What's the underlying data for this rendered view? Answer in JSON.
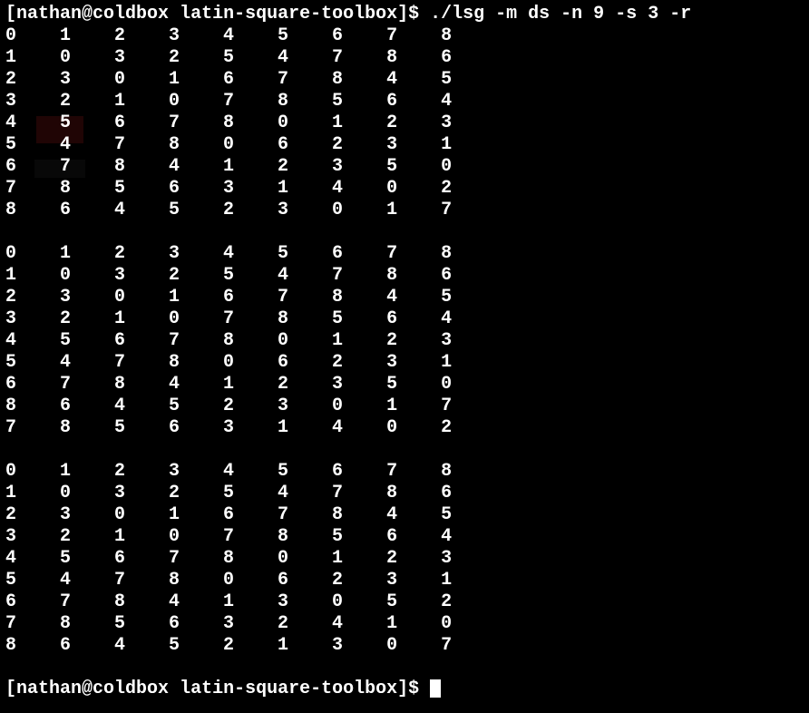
{
  "prompt": {
    "user": "nathan",
    "host": "coldbox",
    "path": "latin-square-toolbox",
    "command": "./lsg -m ds -n 9 -s 3 -r"
  },
  "squares": [
    [
      [
        0,
        1,
        2,
        3,
        4,
        5,
        6,
        7,
        8
      ],
      [
        1,
        0,
        3,
        2,
        5,
        4,
        7,
        8,
        6
      ],
      [
        2,
        3,
        0,
        1,
        6,
        7,
        8,
        4,
        5
      ],
      [
        3,
        2,
        1,
        0,
        7,
        8,
        5,
        6,
        4
      ],
      [
        4,
        5,
        6,
        7,
        8,
        0,
        1,
        2,
        3
      ],
      [
        5,
        4,
        7,
        8,
        0,
        6,
        2,
        3,
        1
      ],
      [
        6,
        7,
        8,
        4,
        1,
        2,
        3,
        5,
        0
      ],
      [
        7,
        8,
        5,
        6,
        3,
        1,
        4,
        0,
        2
      ],
      [
        8,
        6,
        4,
        5,
        2,
        3,
        0,
        1,
        7
      ]
    ],
    [
      [
        0,
        1,
        2,
        3,
        4,
        5,
        6,
        7,
        8
      ],
      [
        1,
        0,
        3,
        2,
        5,
        4,
        7,
        8,
        6
      ],
      [
        2,
        3,
        0,
        1,
        6,
        7,
        8,
        4,
        5
      ],
      [
        3,
        2,
        1,
        0,
        7,
        8,
        5,
        6,
        4
      ],
      [
        4,
        5,
        6,
        7,
        8,
        0,
        1,
        2,
        3
      ],
      [
        5,
        4,
        7,
        8,
        0,
        6,
        2,
        3,
        1
      ],
      [
        6,
        7,
        8,
        4,
        1,
        2,
        3,
        5,
        0
      ],
      [
        8,
        6,
        4,
        5,
        2,
        3,
        0,
        1,
        7
      ],
      [
        7,
        8,
        5,
        6,
        3,
        1,
        4,
        0,
        2
      ]
    ],
    [
      [
        0,
        1,
        2,
        3,
        4,
        5,
        6,
        7,
        8
      ],
      [
        1,
        0,
        3,
        2,
        5,
        4,
        7,
        8,
        6
      ],
      [
        2,
        3,
        0,
        1,
        6,
        7,
        8,
        4,
        5
      ],
      [
        3,
        2,
        1,
        0,
        7,
        8,
        5,
        6,
        4
      ],
      [
        4,
        5,
        6,
        7,
        8,
        0,
        1,
        2,
        3
      ],
      [
        5,
        4,
        7,
        8,
        0,
        6,
        2,
        3,
        1
      ],
      [
        6,
        7,
        8,
        4,
        1,
        3,
        0,
        5,
        2
      ],
      [
        7,
        8,
        5,
        6,
        3,
        2,
        4,
        1,
        0
      ],
      [
        8,
        6,
        4,
        5,
        2,
        1,
        3,
        0,
        7
      ]
    ]
  ],
  "prompt2": {
    "user": "nathan",
    "host": "coldbox",
    "path": "latin-square-toolbox"
  }
}
